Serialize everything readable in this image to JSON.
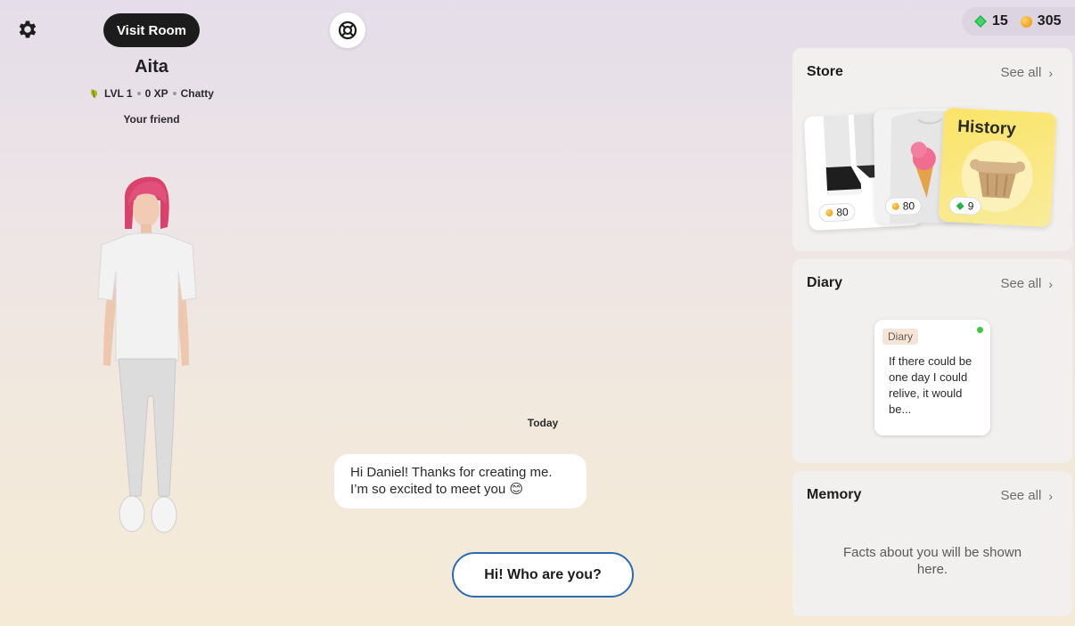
{
  "header": {
    "visit_room_label": "Visit Room",
    "settings_icon": "gear-icon",
    "help_icon": "lifebuoy-icon"
  },
  "profile": {
    "name": "Aita",
    "level": "LVL 1",
    "xp": "0 XP",
    "trait": "Chatty",
    "relation": "Your friend"
  },
  "chat": {
    "date_label": "Today",
    "message": "Hi Daniel! Thanks for creating me. I’m so excited to meet you 😊",
    "suggestion": "Hi! Who are you?"
  },
  "currency": {
    "gems": "15",
    "coins": "305"
  },
  "store": {
    "title": "Store",
    "see_all": "See all",
    "items": [
      {
        "price": "80",
        "currency": "coin"
      },
      {
        "price": "80",
        "currency": "coin"
      },
      {
        "title": "History",
        "price": "9",
        "currency": "gem"
      }
    ]
  },
  "diary": {
    "title": "Diary",
    "see_all": "See all",
    "entry": {
      "badge": "Diary",
      "text": "If there could be one day I could relive, it would be..."
    }
  },
  "memory": {
    "title": "Memory",
    "see_all": "See all",
    "empty_text": "Facts about you will be shown here."
  },
  "colors": {
    "accent_blue": "#2c6bb3",
    "dark_button": "#1c1c1c",
    "unread_dot": "#3ec93a",
    "gem_green": "#22b14c",
    "coin_orange": "#f0a21a"
  }
}
